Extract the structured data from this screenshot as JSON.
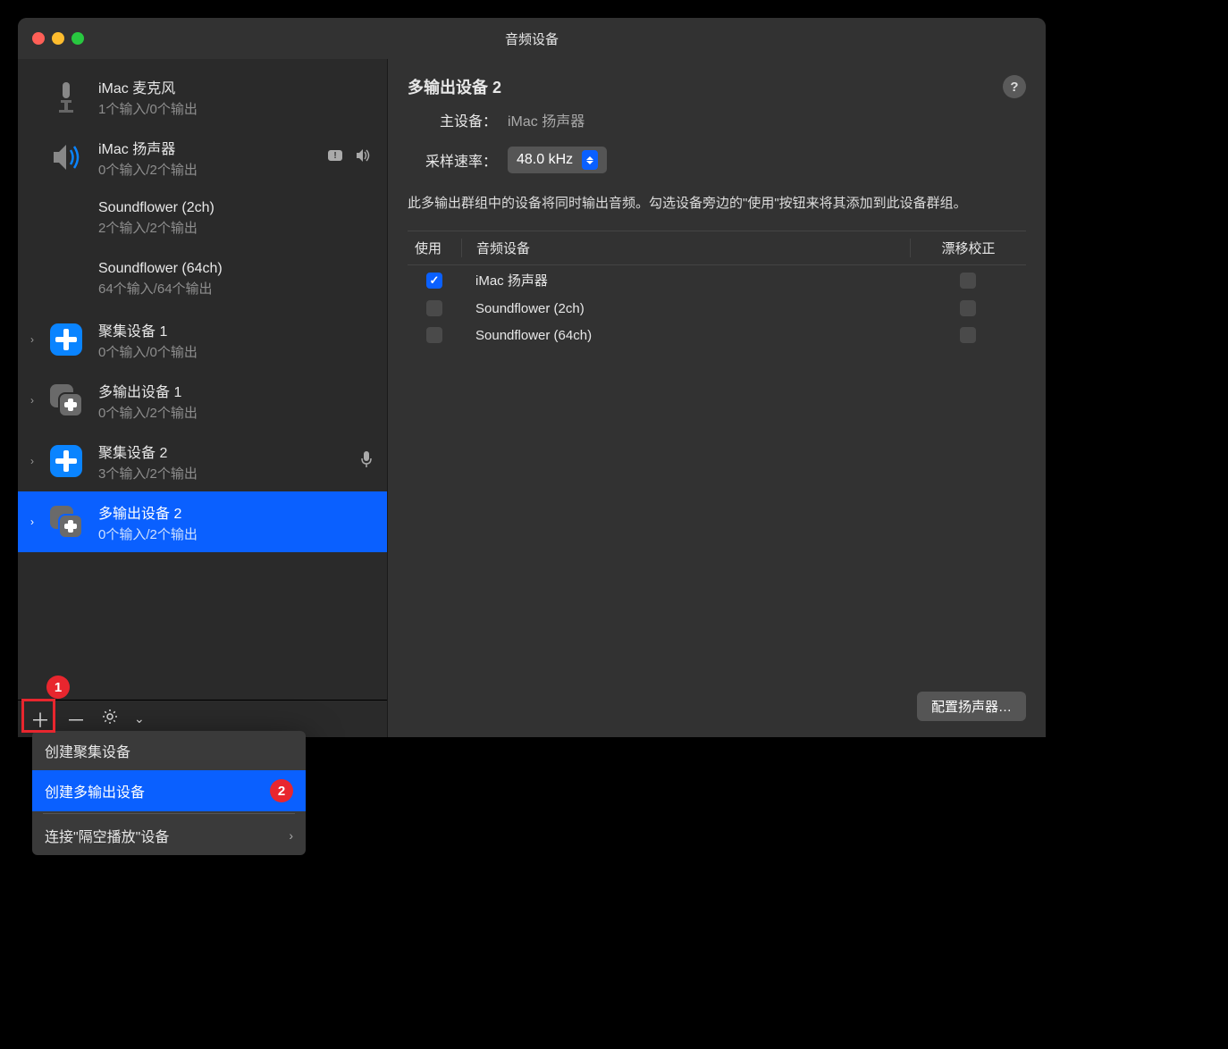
{
  "window": {
    "title": "音频设备"
  },
  "sidebar": {
    "devices": [
      {
        "name": "iMac 麦克风",
        "sub": "1个输入/0个输出",
        "icon": "microphone"
      },
      {
        "name": "iMac 扬声器",
        "sub": "0个输入/2个输出",
        "icon": "speaker",
        "hasVolume": true
      },
      {
        "name": "Soundflower (2ch)",
        "sub": "2个输入/2个输出",
        "icon": "none"
      },
      {
        "name": "Soundflower (64ch)",
        "sub": "64个输入/64个输出",
        "icon": "none"
      },
      {
        "name": "聚集设备 1",
        "sub": "0个输入/0个输出",
        "icon": "aggregate",
        "expandable": true
      },
      {
        "name": "多输出设备 1",
        "sub": "0个输入/2个输出",
        "icon": "multi",
        "expandable": true
      },
      {
        "name": "聚集设备 2",
        "sub": "3个输入/2个输出",
        "icon": "aggregate",
        "expandable": true,
        "hasMic": true
      },
      {
        "name": "多输出设备 2",
        "sub": "0个输入/2个输出",
        "icon": "multi",
        "expandable": true,
        "selected": true
      }
    ]
  },
  "popup": {
    "items": [
      {
        "label": "创建聚集设备"
      },
      {
        "label": "创建多输出设备",
        "highlighted": true,
        "annotation": "2"
      },
      {
        "label": "连接\"隔空播放\"设备",
        "arrow": true,
        "separatorBefore": true
      }
    ]
  },
  "main": {
    "title": "多输出设备 2",
    "masterLabel": "主设备：",
    "masterValue": "iMac 扬声器",
    "sampleRateLabel": "采样速率：",
    "sampleRateValue": "48.0 kHz",
    "description": "此多输出群组中的设备将同时输出音频。勾选设备旁边的\"使用\"按钮来将其添加到此设备群组。",
    "table": {
      "headers": {
        "use": "使用",
        "name": "音频设备",
        "drift": "漂移校正"
      },
      "rows": [
        {
          "name": "iMac 扬声器",
          "use": true,
          "drift": false
        },
        {
          "name": "Soundflower (2ch)",
          "use": false,
          "drift": false
        },
        {
          "name": "Soundflower (64ch)",
          "use": false,
          "drift": false
        }
      ]
    },
    "configButton": "配置扬声器…"
  },
  "annotations": {
    "one": "1",
    "two": "2"
  }
}
